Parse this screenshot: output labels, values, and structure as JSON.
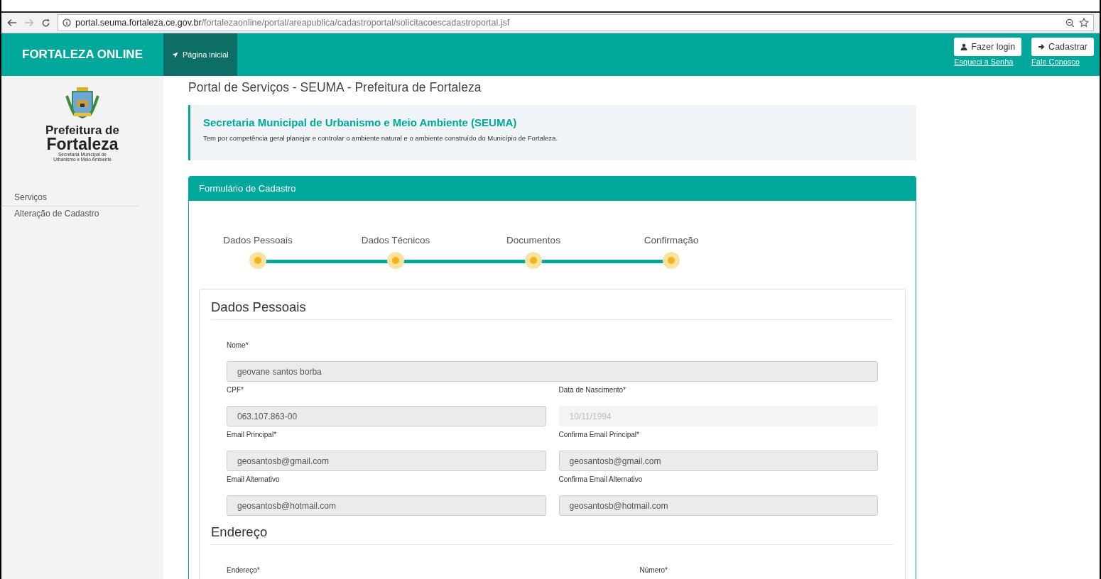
{
  "browser": {
    "url_host": "portal.seuma.fortaleza.ce.gov.br",
    "url_path": "/fortalezaonline/portal/areapublica/cadastroportal/solicitacoescadastroportal.jsf"
  },
  "navbar": {
    "brand": "FORTALEZA ONLINE",
    "items": [
      {
        "label": "Página inicial",
        "selected": true
      }
    ],
    "buttons": [
      {
        "label": "Fazer login",
        "kind": "user",
        "link": "Esqueci a Senha"
      },
      {
        "label": "Cadastrar",
        "kind": "arrow",
        "link": "Fale Conosco"
      }
    ]
  },
  "sidebar": {
    "logo": {
      "line1": "Prefeitura de",
      "line2": "Fortaleza",
      "sub1": "Secretaria Municipal de",
      "sub2": "Urbanismo e Meio Ambiente"
    },
    "items": [
      {
        "label": "Serviços",
        "kind": "header"
      },
      {
        "label": "Alteração de Cadastro",
        "kind": "link"
      }
    ]
  },
  "page_title": "Portal de Serviços - SEUMA - Prefeitura de Fortaleza",
  "intro": {
    "title": "Secretaria Municipal de Urbanismo e Meio Ambiente (SEUMA)",
    "text": "Tem por competência geral planejar e controlar o ambiente natural e o ambiente construído do Município de Fortaleza."
  },
  "form": {
    "title": "Formulário de Cadastro",
    "steps": [
      {
        "label": "Dados Pessoais"
      },
      {
        "label": "Dados Técnicos"
      },
      {
        "label": "Documentos"
      },
      {
        "label": "Confirmação"
      }
    ],
    "sections": [
      {
        "title": "Dados Pessoais",
        "rows": [
          [
            {
              "label": "Nome*",
              "value": "geovane santos borba",
              "disabled": false
            }
          ],
          [
            {
              "label": "CPF*",
              "value": "063.107.863-00",
              "disabled": false
            },
            {
              "label": "Data de Nascimento*",
              "value": "10/11/1994",
              "disabled": true
            }
          ],
          [
            {
              "label": "Email Principal*",
              "value": "geosantosb@gmail.com",
              "disabled": false
            },
            {
              "label": "Confirma Email Principal*",
              "value": "geosantosb@gmail.com",
              "disabled": false
            }
          ],
          [
            {
              "label": "Email Alternativo",
              "value": "geosantosb@hotmail.com",
              "disabled": false
            },
            {
              "label": "Confirma Email Alternativo",
              "value": "geosantosb@hotmail.com",
              "disabled": false
            }
          ]
        ]
      },
      {
        "title": "Endereço",
        "labels": [
          "Endereço*",
          "Número*"
        ]
      }
    ]
  }
}
